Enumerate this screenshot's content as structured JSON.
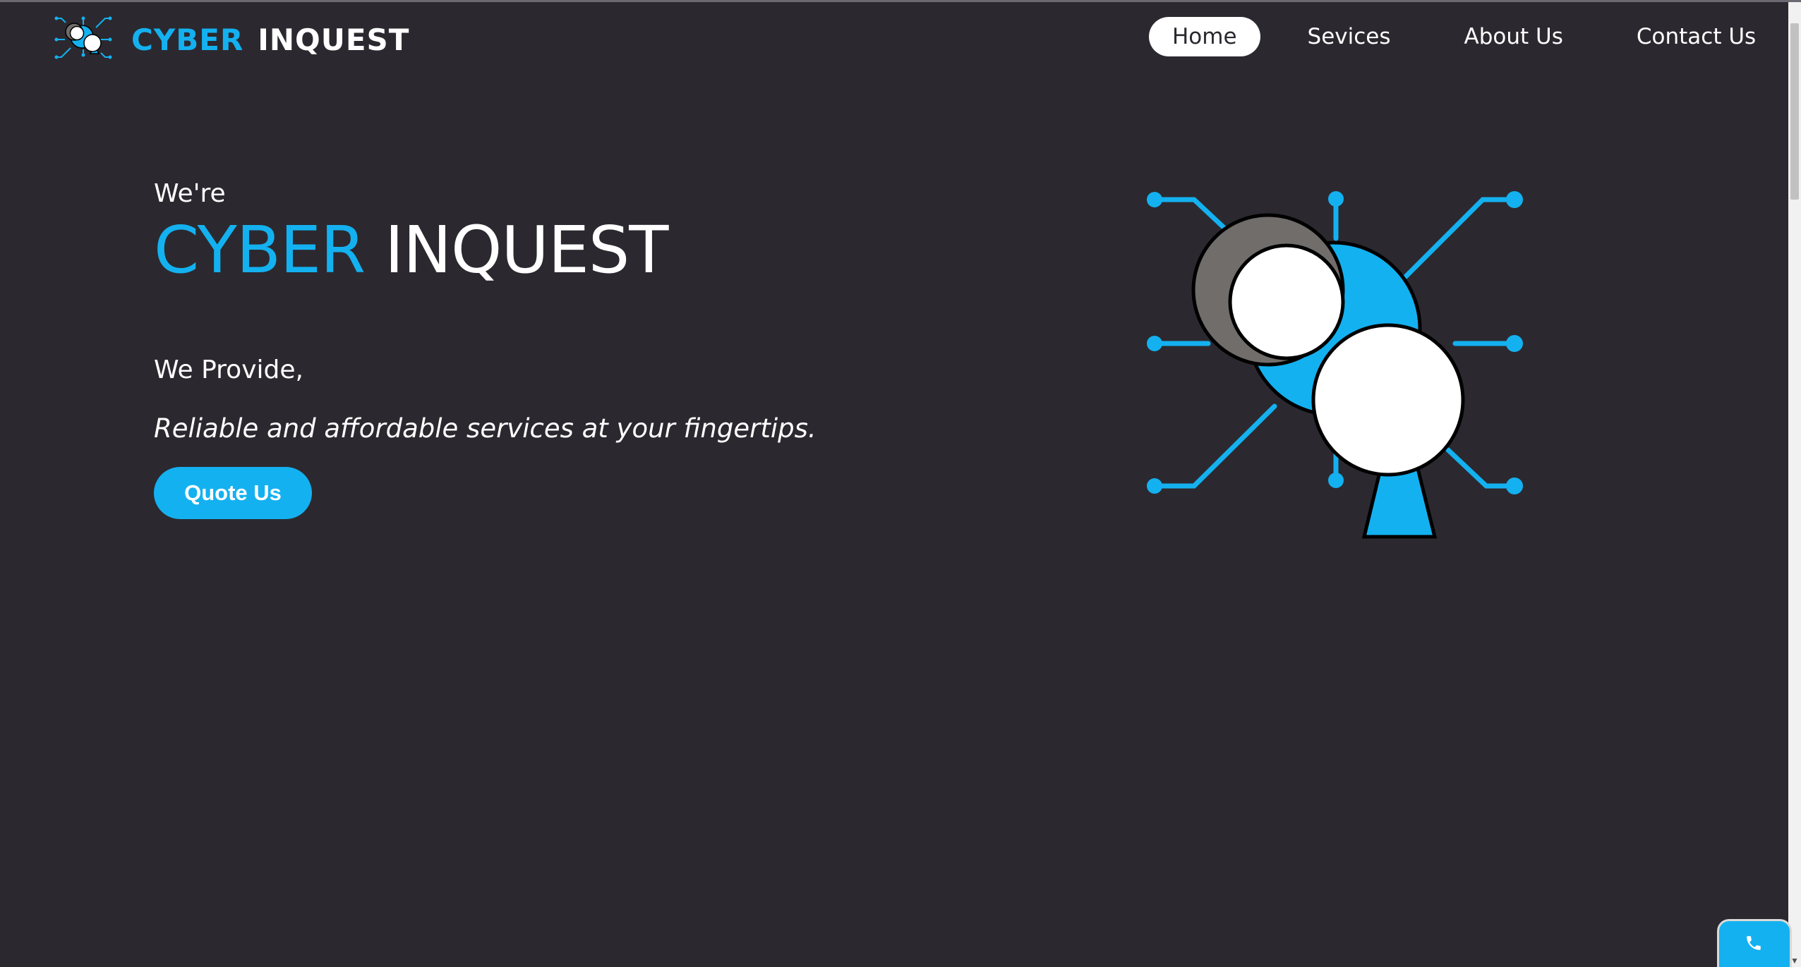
{
  "brand": {
    "name_part1": "CYBER",
    "name_part2": "INQUEST",
    "logo_icon": "cyber-inquest-logo-icon"
  },
  "nav": {
    "items": [
      {
        "label": "Home",
        "active": true
      },
      {
        "label": "Sevices",
        "active": false
      },
      {
        "label": "About Us",
        "active": false
      },
      {
        "label": "Contact Us",
        "active": false
      }
    ]
  },
  "hero": {
    "intro": "We're",
    "title_part1": "CYBER",
    "title_part2": "INQUEST",
    "provide": "We Provide,",
    "tagline": "Reliable and affordable services at your fingertips.",
    "cta_label": "Quote Us",
    "illustration_icon": "cyber-inquest-illustration"
  },
  "floating_contact": {
    "icon": "phone-icon"
  },
  "colors": {
    "background": "#2b292f",
    "accent": "#14b1f0",
    "text": "#ffffff",
    "gray_circle": "#706d6b"
  }
}
